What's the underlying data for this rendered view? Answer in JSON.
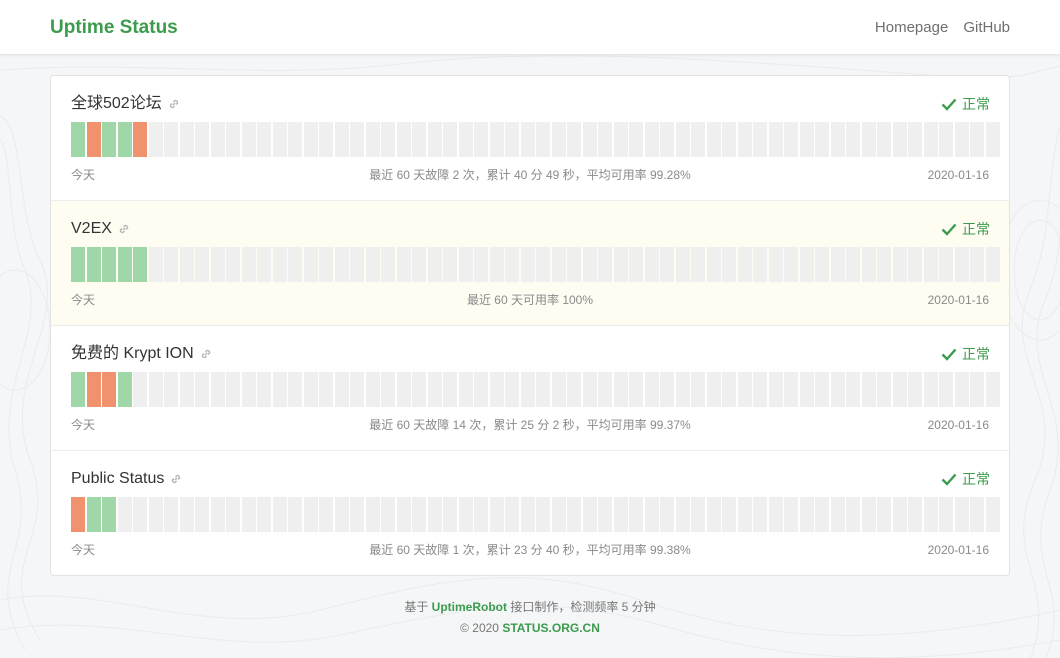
{
  "header": {
    "brand": "Uptime Status",
    "nav": [
      "Homepage",
      "GitHub"
    ]
  },
  "colors": {
    "accent": "#3c9b4d",
    "bar_ok": "#9fd7a9",
    "bar_down": "#f0926d",
    "bar_empty": "#efefef",
    "highlight_row": "#fffcf2"
  },
  "monitors": [
    {
      "name": "全球502论坛",
      "status": "正常",
      "left_label": "今天",
      "summary": "最近 60 天故障 2 次，累计 40 分 49 秒，平均可用率 99.28%",
      "date": "2020-01-16",
      "bars": [
        "ok",
        "down",
        "ok",
        "ok",
        "down"
      ]
    },
    {
      "name": "V2EX",
      "status": "正常",
      "left_label": "今天",
      "summary": "最近 60 天可用率 100%",
      "date": "2020-01-16",
      "bars": [
        "ok",
        "ok",
        "ok",
        "ok",
        "ok"
      ]
    },
    {
      "name": "免费的 Krypt ION",
      "status": "正常",
      "left_label": "今天",
      "summary": "最近 60 天故障 14 次，累计 25 分 2 秒，平均可用率 99.37%",
      "date": "2020-01-16",
      "bars": [
        "ok",
        "down",
        "down",
        "ok"
      ]
    },
    {
      "name": "Public Status",
      "status": "正常",
      "left_label": "今天",
      "summary": "最近 60 天故障 1 次，累计 23 分 40 秒，平均可用率 99.38%",
      "date": "2020-01-16",
      "bars": [
        "down",
        "ok",
        "ok"
      ]
    }
  ],
  "footer": {
    "line1_prefix": "基于",
    "line1_link": "UptimeRobot",
    "line1_suffix": "接口制作，检测频率 5 分钟",
    "line2_prefix": "© 2020",
    "line2_link": "STATUS.ORG.CN"
  }
}
